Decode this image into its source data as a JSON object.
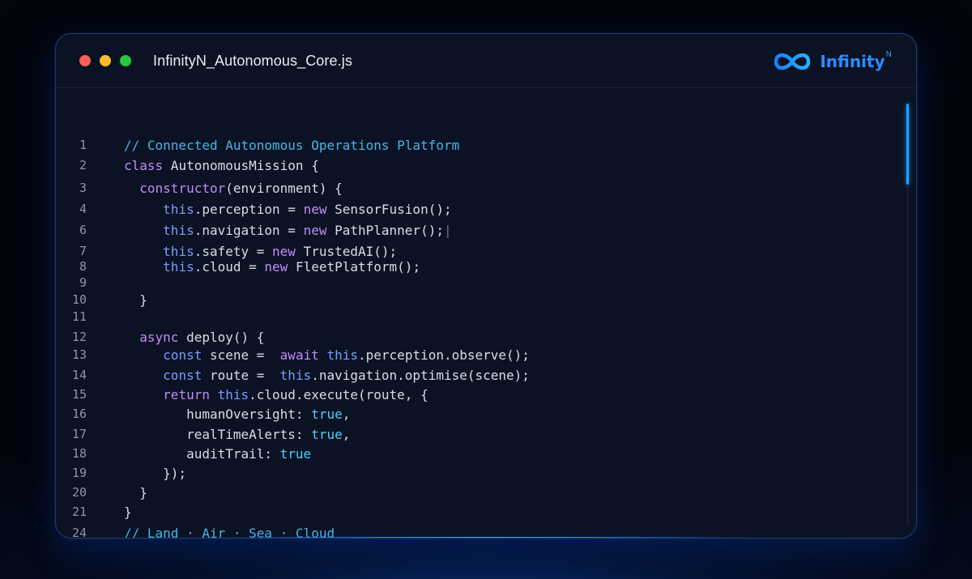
{
  "window": {
    "filename": "InfinityN_Autonomous_Core.js",
    "brand": {
      "name": "Infinity",
      "superscript": "N",
      "icon": "infinity-logo-icon"
    }
  },
  "colors": {
    "comment": "#45b6e8",
    "keyword": "#c58af9",
    "this": "#7b9cff",
    "plain": "#d7dde8",
    "bool": "#4fd0ff",
    "brand": "#2d8cff"
  },
  "code": {
    "lines": [
      {
        "n": "1",
        "tokens": [
          [
            "comment",
            "// Connected Autonomous Operations Platform"
          ]
        ]
      },
      {
        "n": "2",
        "tokens": [
          [
            "kw",
            "class"
          ],
          [
            "plain",
            " AutonomousMission {"
          ]
        ]
      },
      {
        "n": "3",
        "tokens": [
          [
            "plain",
            "  "
          ],
          [
            "kw",
            "constructor"
          ],
          [
            "plain",
            "(environment) {"
          ]
        ]
      },
      {
        "n": "4",
        "tokens": [
          [
            "plain",
            "     "
          ],
          [
            "this",
            "this"
          ],
          [
            "plain",
            ".perception = "
          ],
          [
            "kw",
            "new"
          ],
          [
            "plain",
            " SensorFusion();"
          ]
        ]
      },
      {
        "n": "6",
        "tokens": [
          [
            "plain",
            "     "
          ],
          [
            "this",
            "this"
          ],
          [
            "plain",
            ".navigation = "
          ],
          [
            "kw",
            "new"
          ],
          [
            "plain",
            " PathPlanner();"
          ],
          [
            "cursor",
            "|"
          ]
        ]
      },
      {
        "n": "7",
        "tokens": [
          [
            "plain",
            "     "
          ],
          [
            "this",
            "this"
          ],
          [
            "plain",
            ".safety = "
          ],
          [
            "kw",
            "new"
          ],
          [
            "plain",
            " TrustedAI();"
          ]
        ]
      },
      {
        "n": "8",
        "tokens": [
          [
            "plain",
            "     "
          ],
          [
            "this",
            "this"
          ],
          [
            "plain",
            ".cloud = "
          ],
          [
            "kw",
            "new"
          ],
          [
            "plain",
            " FleetPlatform();"
          ]
        ]
      },
      {
        "n": "9",
        "tokens": []
      },
      {
        "n": "10",
        "tokens": [
          [
            "plain",
            "  }"
          ]
        ]
      },
      {
        "n": "11",
        "tokens": []
      },
      {
        "n": "12",
        "tokens": [
          [
            "plain",
            "  "
          ],
          [
            "kw",
            "async"
          ],
          [
            "plain",
            " deploy() {"
          ]
        ]
      },
      {
        "n": "13",
        "tokens": [
          [
            "plain",
            "     "
          ],
          [
            "this",
            "const"
          ],
          [
            "plain",
            " scene =  "
          ],
          [
            "kw",
            "await"
          ],
          [
            "plain",
            " "
          ],
          [
            "this",
            "this"
          ],
          [
            "plain",
            ".perception.observe();"
          ]
        ]
      },
      {
        "n": "14",
        "tokens": [
          [
            "plain",
            "     "
          ],
          [
            "this",
            "const"
          ],
          [
            "plain",
            " route =  "
          ],
          [
            "this",
            "this"
          ],
          [
            "plain",
            ".navigation.optimise(scene);"
          ]
        ]
      },
      {
        "n": "15",
        "tokens": [
          [
            "plain",
            "     "
          ],
          [
            "kw",
            "return"
          ],
          [
            "plain",
            " "
          ],
          [
            "this",
            "this"
          ],
          [
            "plain",
            ".cloud.execute(route, {"
          ]
        ]
      },
      {
        "n": "16",
        "tokens": [
          [
            "plain",
            "        humanOversight: "
          ],
          [
            "bool",
            "true"
          ],
          [
            "plain",
            ","
          ]
        ]
      },
      {
        "n": "17",
        "tokens": [
          [
            "plain",
            "        realTimeAlerts: "
          ],
          [
            "bool",
            "true"
          ],
          [
            "plain",
            ","
          ]
        ]
      },
      {
        "n": "18",
        "tokens": [
          [
            "plain",
            "        auditTrail: "
          ],
          [
            "bool",
            "true"
          ]
        ]
      },
      {
        "n": "19",
        "tokens": [
          [
            "plain",
            "     });"
          ]
        ]
      },
      {
        "n": "20",
        "tokens": [
          [
            "plain",
            "  }"
          ]
        ]
      },
      {
        "n": "21",
        "tokens": [
          [
            "plain",
            "}"
          ]
        ]
      },
      {
        "n": "24",
        "tokens": [
          [
            "comment",
            "// Land · Air · Sea · Cloud"
          ]
        ]
      }
    ]
  }
}
